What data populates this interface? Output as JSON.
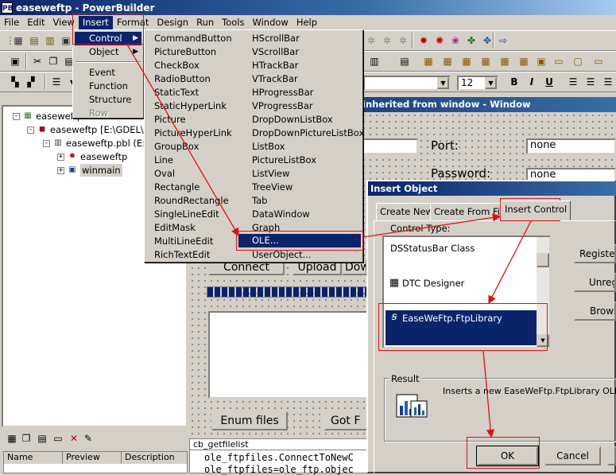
{
  "window": {
    "title": "easeweftp - PowerBuilder",
    "app_icon": "PB"
  },
  "menubar": [
    "File",
    "Edit",
    "View",
    "Insert",
    "Format",
    "Design",
    "Run",
    "Tools",
    "Window",
    "Help"
  ],
  "insert_menu": {
    "items": [
      {
        "label": "Control",
        "highlighted": true,
        "submenu": true
      },
      {
        "label": "Object",
        "submenu": true
      },
      {
        "label": "Event"
      },
      {
        "label": "Function"
      },
      {
        "label": "Structure"
      },
      {
        "label": "Row",
        "disabled": true
      }
    ]
  },
  "control_menu": {
    "col1": [
      "CommandButton",
      "PictureButton",
      "CheckBox",
      "RadioButton",
      "StaticText",
      "StaticHyperLink",
      "Picture",
      "PictureHyperLink",
      "GroupBox",
      "Line",
      "Oval",
      "Rectangle",
      "RoundRectangle",
      "SingleLineEdit",
      "EditMask",
      "MultiLineEdit",
      "RichTextEdit"
    ],
    "col2": [
      "HScrollBar",
      "VScrollBar",
      "HTrackBar",
      "VTrackBar",
      "HProgressBar",
      "VProgressBar",
      "DropDownListBox",
      "DropDownPictureListBox",
      "ListBox",
      "PictureListBox",
      "ListView",
      "TreeView",
      "Tab",
      "DataWindow",
      "Graph",
      "OLE...",
      "UserObject..."
    ],
    "highlighted": "OLE..."
  },
  "toolbar": {
    "font_size": "12",
    "bold": "B",
    "italic": "I",
    "underline": "U"
  },
  "tree": {
    "items": [
      {
        "label": "easeweftp",
        "level": 0,
        "expander": "-"
      },
      {
        "label": "easeweftp [E:\\GDEL\\S",
        "level": 1,
        "expander": "-"
      },
      {
        "label": "easeweftp.pbl (E:\\",
        "level": 2,
        "expander": "-"
      },
      {
        "label": "easeweftp",
        "level": 3,
        "expander": "+"
      },
      {
        "label": "winmain",
        "level": 3,
        "expander": "+",
        "selected": true
      }
    ]
  },
  "workspace": {
    "title": "inherited from window - Window",
    "port_label": "Port:",
    "port_value": "none",
    "password_label": "Password:",
    "password_value": "none",
    "buttons": [
      "Connect",
      "Upload",
      "Dow"
    ],
    "enum_button": "Enum files",
    "get_button": "Got F"
  },
  "dialog": {
    "title": "Insert Object",
    "tabs": [
      "Create New",
      "Create From File",
      "Insert Control"
    ],
    "active_tab": "Insert Control",
    "control_type_label": "Control Type:",
    "list": [
      {
        "label": "DSStatusBar Class"
      },
      {
        "label": "DTC Designer"
      },
      {
        "label": "EaseWeFtp.FtpLibrary",
        "selected": true
      }
    ],
    "side_buttons": [
      "Register N",
      "Unregis",
      "Brows"
    ],
    "result_label": "Result",
    "result_text": "Inserts a new EaseWeFtp.FtpLibrary OLE custom control into your document.",
    "ok": "OK",
    "cancel": "Cancel"
  },
  "properties": {
    "columns": [
      "Name",
      "Preview",
      "Description"
    ]
  },
  "script": {
    "event": "cb_getfilelist",
    "lines": [
      "ole_ftpfiles.ConnectToNewC",
      "ole_ftpfiles=ole_ftp.objec"
    ]
  },
  "colors": {
    "highlight": "#0a246a",
    "annotation": "#e01010",
    "face": "#d4d0c8"
  }
}
